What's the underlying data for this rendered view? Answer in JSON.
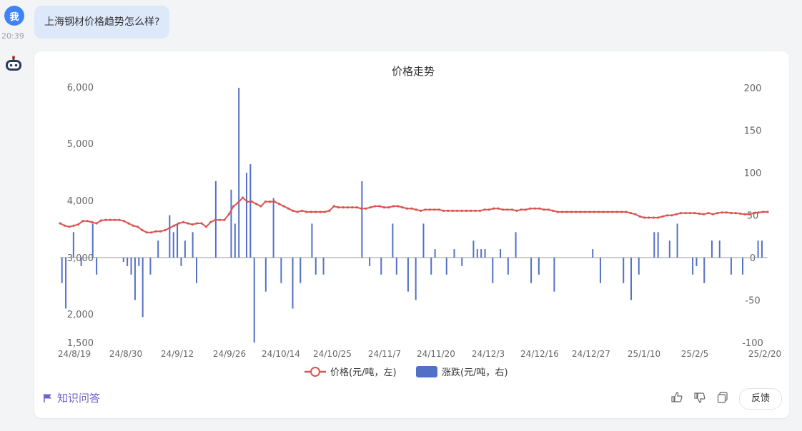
{
  "user_message": {
    "avatar_text": "我",
    "time": "20:39",
    "text": "上海钢材价格趋势怎么样?"
  },
  "bot_card": {
    "source_label": "知识问答",
    "feedback_label": "反馈"
  },
  "chart_data": {
    "type": "bar-line",
    "title": "价格走势",
    "legend": [
      "价格(元/吨，左)",
      "涨跌(元/吨，右)"
    ],
    "legend_position": "bottom",
    "left_axis": {
      "ticks": [
        "6,000",
        "5,000",
        "4,000",
        "3,000",
        "2,000",
        "1,500"
      ]
    },
    "right_axis": {
      "ticks": [
        "200",
        "150",
        "100",
        "50",
        "0",
        "-50",
        "-100"
      ],
      "range": [
        -100,
        200
      ]
    },
    "x_labels": [
      "24/8/19",
      "24/8/30",
      "24/9/12",
      "24/9/26",
      "24/10/14",
      "24/10/25",
      "24/11/7",
      "24/11/20",
      "24/12/3",
      "24/12/16",
      "24/12/27",
      "25/1/10",
      "25/2/5",
      "25/2/20"
    ],
    "price_series": {
      "name": "价格(元/吨，左)",
      "color": "#d9534f",
      "values": [
        3600,
        3560,
        3540,
        3560,
        3580,
        3640,
        3640,
        3620,
        3600,
        3650,
        3660,
        3660,
        3660,
        3660,
        3640,
        3600,
        3560,
        3540,
        3480,
        3440,
        3440,
        3460,
        3460,
        3480,
        3520,
        3560,
        3600,
        3620,
        3600,
        3580,
        3600,
        3600,
        3540,
        3620,
        3660,
        3660,
        3660,
        3760,
        3900,
        3960,
        4050,
        3980,
        3980,
        3940,
        3900,
        3980,
        3980,
        3980,
        3940,
        3900,
        3860,
        3820,
        3800,
        3820,
        3800,
        3800,
        3800,
        3800,
        3800,
        3820,
        3900,
        3880,
        3880,
        3880,
        3880,
        3880,
        3860,
        3860,
        3880,
        3900,
        3900,
        3880,
        3880,
        3900,
        3900,
        3880,
        3860,
        3860,
        3840,
        3820,
        3840,
        3840,
        3840,
        3840,
        3820,
        3820,
        3820,
        3820,
        3820,
        3820,
        3820,
        3820,
        3820,
        3840,
        3840,
        3860,
        3860,
        3840,
        3840,
        3840,
        3820,
        3840,
        3840,
        3860,
        3860,
        3860,
        3840,
        3840,
        3820,
        3800,
        3800,
        3800,
        3800,
        3800,
        3800,
        3800,
        3800,
        3800,
        3800,
        3800,
        3800,
        3800,
        3800,
        3800,
        3800,
        3780,
        3760,
        3720,
        3700,
        3700,
        3700,
        3700,
        3720,
        3740,
        3740,
        3760,
        3780,
        3780,
        3780,
        3780,
        3770,
        3760,
        3780,
        3760,
        3780,
        3790,
        3790,
        3780,
        3780,
        3770,
        3760,
        3760,
        3780,
        3790,
        3800,
        3800
      ]
    },
    "change_series": {
      "name": "涨跌(元/吨，右)",
      "color": "#5470c6",
      "values": [
        -30,
        -60,
        0,
        30,
        0,
        -10,
        0,
        0,
        40,
        -20,
        0,
        0,
        0,
        0,
        0,
        0,
        -5,
        -10,
        -20,
        -50,
        -10,
        -70,
        0,
        -20,
        0,
        20,
        0,
        0,
        50,
        30,
        40,
        -10,
        20,
        0,
        30,
        -30,
        0,
        0,
        0,
        0,
        90,
        0,
        0,
        0,
        80,
        40,
        200,
        0,
        100,
        110,
        -100,
        0,
        0,
        -40,
        0,
        70,
        0,
        -30,
        0,
        0,
        -60,
        0,
        -30,
        0,
        0,
        40,
        -20,
        0,
        -20,
        0,
        0,
        0,
        0,
        0,
        0,
        0,
        0,
        0,
        90,
        0,
        -10,
        0,
        0,
        -20,
        0,
        0,
        40,
        -20,
        0,
        0,
        -40,
        0,
        -50,
        0,
        40,
        0,
        -20,
        10,
        0,
        0,
        -20,
        0,
        10,
        0,
        -10,
        0,
        0,
        20,
        10,
        10,
        10,
        0,
        -30,
        0,
        10,
        0,
        -20,
        0,
        30,
        0,
        0,
        0,
        -30,
        0,
        -20,
        0,
        0,
        0,
        -40,
        0,
        0,
        0,
        0,
        0,
        0,
        0,
        0,
        0,
        10,
        0,
        -30,
        0,
        0,
        0,
        0,
        0,
        -30,
        0,
        -50,
        0,
        -20,
        0,
        0,
        0,
        30,
        30,
        0,
        0,
        20,
        0,
        40,
        0,
        0,
        0,
        -20,
        -10,
        0,
        -30,
        0,
        20,
        0,
        20,
        0,
        0,
        -20,
        0,
        0,
        -20,
        0,
        0,
        0,
        20,
        20,
        0
      ]
    }
  },
  "icons": [
    "thumbs-up-icon",
    "thumbs-down-icon",
    "copy-icon",
    "flag-icon",
    "robot-icon"
  ]
}
